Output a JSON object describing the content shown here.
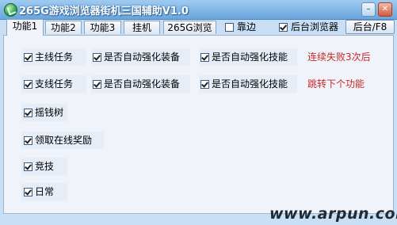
{
  "window": {
    "title": "265G游戏浏览器街机三国辅助V1.0",
    "min": "–",
    "close": "✕"
  },
  "tabs": [
    "功能1",
    "功能2",
    "功能3",
    "挂机",
    "265G浏览器"
  ],
  "toolbar": {
    "dock_label": "靠边",
    "dock_checked": false,
    "bg_browser_label": "后台浏览器",
    "bg_browser_checked": true,
    "hotkey_button": "后台/F8"
  },
  "features": {
    "main_quest": "主线任务",
    "main_equip": "是否自动强化装备",
    "main_skill": "是否自动强化技能",
    "main_note": "连续失败3次后",
    "side_quest": "支线任务",
    "side_equip": "是否自动强化装备",
    "side_skill": "是否自动强化技能",
    "side_note": "跳转下个功能",
    "money_tree": "摇钱树",
    "online_reward": "领取在线奖励",
    "arena": "竞技",
    "daily": "日常"
  },
  "watermark": "www.arpun.com"
}
